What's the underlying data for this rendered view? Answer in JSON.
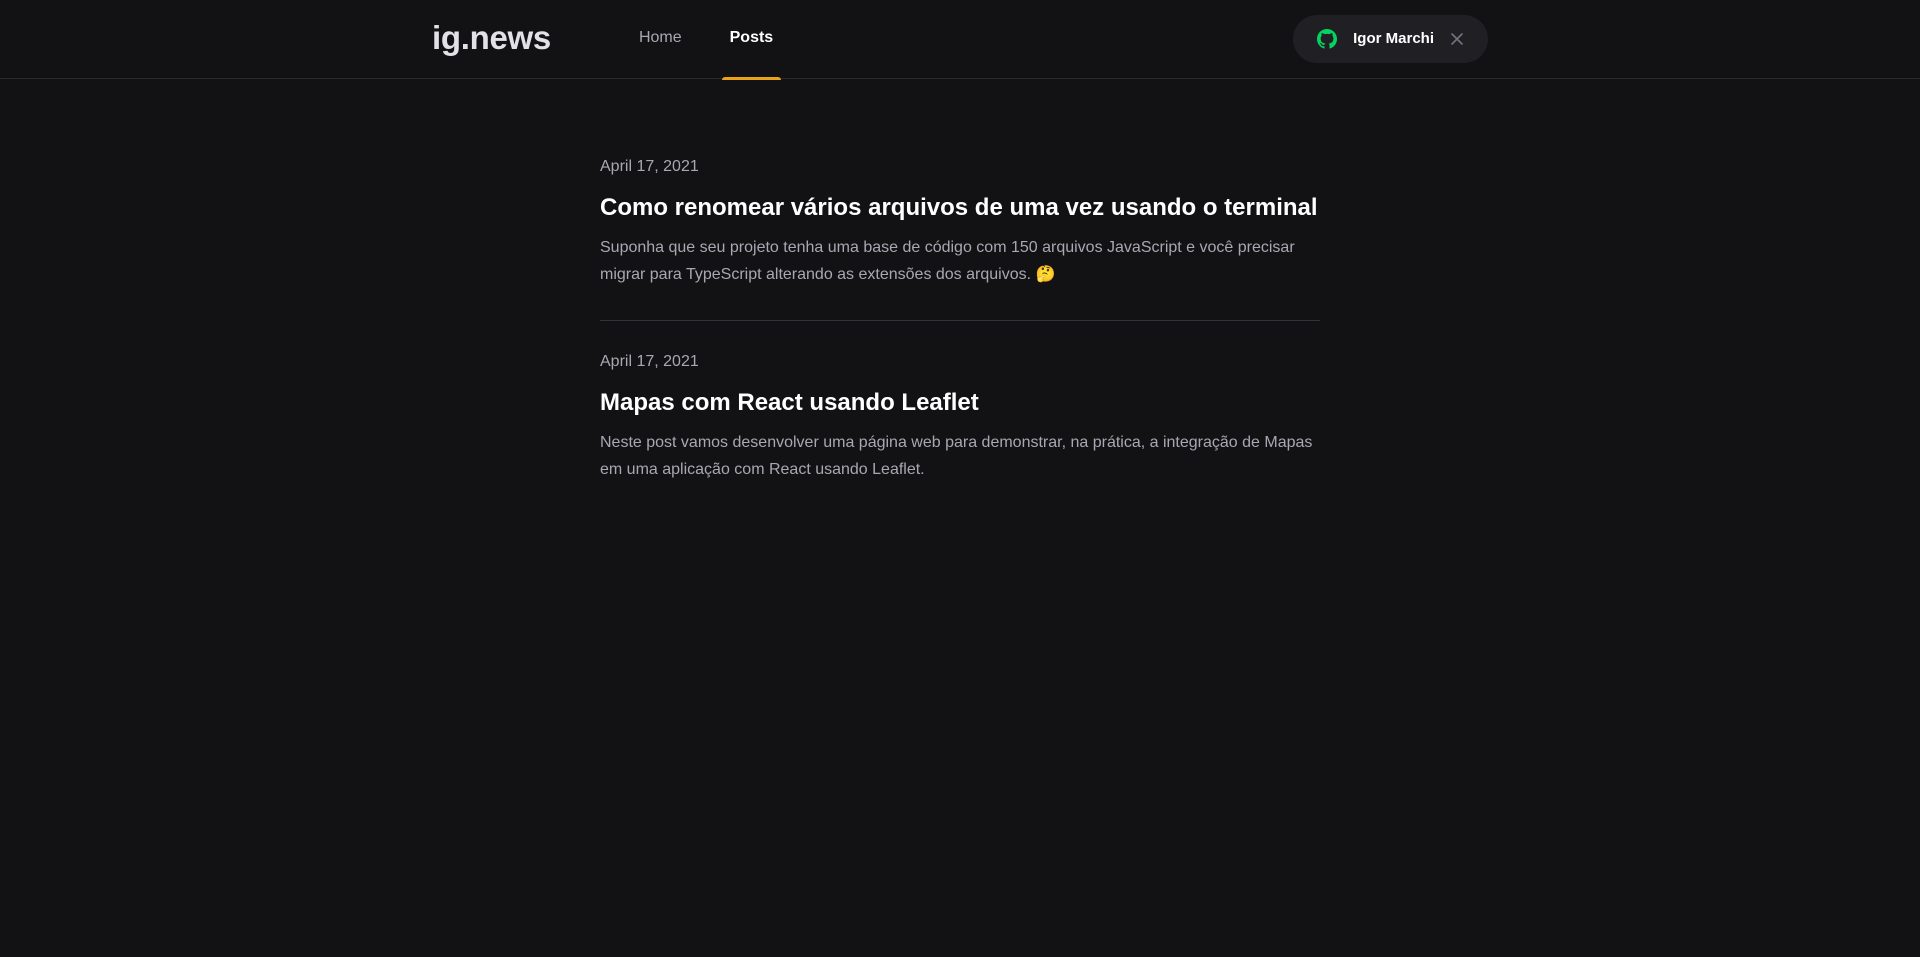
{
  "header": {
    "logo": "ig.news",
    "nav": [
      {
        "label": "Home",
        "active": false
      },
      {
        "label": "Posts",
        "active": true
      }
    ],
    "user": {
      "name": "Igor Marchi",
      "icon": "github-icon",
      "icon_color": "#04d361",
      "close_icon": "close-icon"
    },
    "accent_color": "#eba417"
  },
  "posts": [
    {
      "date": "April 17, 2021",
      "title": "Como renomear vários arquivos de uma vez usando o terminal",
      "excerpt": "Suponha que seu projeto tenha uma base de código com 150 arquivos JavaScript e você precisar migrar para TypeScript alterando as extensões dos arquivos. 🤔"
    },
    {
      "date": "April 17, 2021",
      "title": "Mapas com React usando Leaflet",
      "excerpt": "Neste post vamos desenvolver uma página web para demonstrar, na prática, a integração de Mapas em uma aplicação com React usando Leaflet."
    }
  ]
}
